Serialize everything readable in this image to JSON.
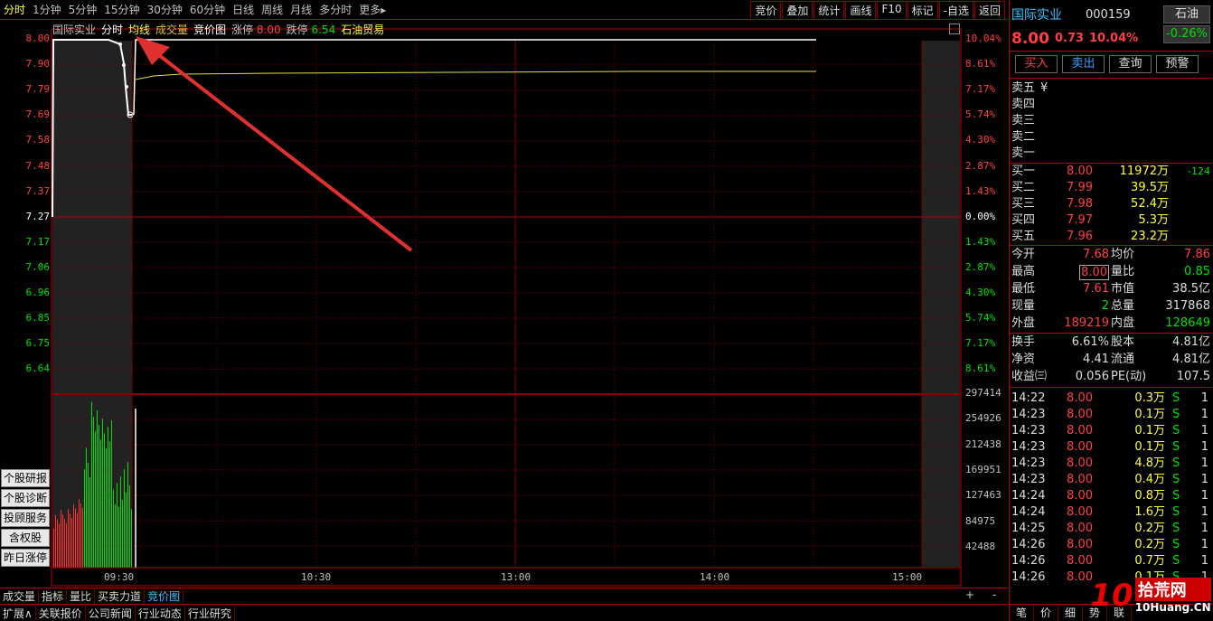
{
  "toolbar": {
    "periods": [
      "分时",
      "1分钟",
      "5分钟",
      "15分钟",
      "30分钟",
      "60分钟",
      "日线",
      "周线",
      "月线",
      "多分时",
      "更多▸"
    ],
    "buttons": [
      "竞价",
      "叠加",
      "统计",
      "画线",
      "F10",
      "标记",
      "-自选",
      "返回"
    ]
  },
  "chart_header": {
    "name": "国际实业",
    "mode": "分时",
    "avg_label": "均线",
    "vol_label": "成交量",
    "auction_label": "竞价图",
    "limit_up_label": "涨停",
    "limit_up": "8.00",
    "limit_down_label": "跌停",
    "limit_down": "6.54",
    "sector": "石油贸易"
  },
  "price_axis": {
    "labels": [
      "8.00",
      "7.90",
      "7.79",
      "7.69",
      "7.58",
      "7.48",
      "7.37",
      "7.27",
      "7.17",
      "7.06",
      "6.96",
      "6.85",
      "6.75",
      "6.64"
    ],
    "pct": [
      "10.04%",
      "8.61%",
      "7.17%",
      "5.74%",
      "4.30%",
      "2.87%",
      "1.43%",
      "0.00%",
      "1.43%",
      "2.87%",
      "4.30%",
      "5.74%",
      "7.17%",
      "8.61%"
    ]
  },
  "volume_axis": {
    "labels": [
      "297414",
      "254926",
      "212438",
      "169951",
      "127463",
      "84975",
      "42488"
    ]
  },
  "time_axis": [
    "09:30",
    "10:30",
    "13:00",
    "14:00",
    "15:00"
  ],
  "side_buttons": [
    "个股研报",
    "个股诊断",
    "投顾服务",
    "含权股",
    "昨日涨停"
  ],
  "bottom_tabs1": [
    "成交量",
    "指标",
    "量比",
    "买卖力道",
    "竞价图"
  ],
  "bottom_tabs2": [
    "扩展∧",
    "关联报价",
    "公司新闻",
    "行业动态",
    "行业研究"
  ],
  "bottom_icons": [
    "+",
    "-"
  ],
  "stock": {
    "name": "国际实业",
    "code": "000159",
    "sector": "石油",
    "sector_change": "-0.26%",
    "price": "8.00",
    "change": "0.73",
    "pct": "10.04%"
  },
  "trade_buttons": [
    "买入",
    "卖出",
    "查询",
    "预警"
  ],
  "asks": [
    {
      "label": "卖五",
      "price": "¥"
    },
    {
      "label": "卖四"
    },
    {
      "label": "卖三"
    },
    {
      "label": "卖二"
    },
    {
      "label": "卖一"
    }
  ],
  "bids": [
    {
      "label": "买一",
      "price": "8.00",
      "vol": "11972万",
      "chg": "-124"
    },
    {
      "label": "买二",
      "price": "7.99",
      "vol": "39.5万"
    },
    {
      "label": "买三",
      "price": "7.98",
      "vol": "52.4万"
    },
    {
      "label": "买四",
      "price": "7.97",
      "vol": "5.3万"
    },
    {
      "label": "买五",
      "price": "7.96",
      "vol": "23.2万"
    }
  ],
  "stats": [
    {
      "l1": "今开",
      "v1": "7.68",
      "l2": "均价",
      "v2": "7.86"
    },
    {
      "l1": "最高",
      "v1": "8.00",
      "l2": "量比",
      "v2": "0.85"
    },
    {
      "l1": "最低",
      "v1": "7.61",
      "l2": "市值",
      "v2": "38.5亿"
    },
    {
      "l1": "现量",
      "v1": "2",
      "l2": "总量",
      "v2": "317868"
    },
    {
      "l1": "外盘",
      "v1": "189219",
      "l2": "内盘",
      "v2": "128649"
    }
  ],
  "stats2": [
    {
      "l1": "换手",
      "v1": "6.61%",
      "l2": "股本",
      "v2": "4.81亿"
    },
    {
      "l1": "净资",
      "v1": "4.41",
      "l2": "流通",
      "v2": "4.81亿"
    },
    {
      "l1": "收益㈢",
      "v1": "0.056",
      "l2": "PE(动)",
      "v2": "107.5"
    }
  ],
  "ticks": [
    {
      "t": "14:22",
      "p": "8.00",
      "v": "0.3万",
      "s": "S",
      "n": "1"
    },
    {
      "t": "14:23",
      "p": "8.00",
      "v": "0.1万",
      "s": "S",
      "n": "1"
    },
    {
      "t": "14:23",
      "p": "8.00",
      "v": "0.1万",
      "s": "S",
      "n": "1"
    },
    {
      "t": "14:23",
      "p": "8.00",
      "v": "0.1万",
      "s": "S",
      "n": "1"
    },
    {
      "t": "14:23",
      "p": "8.00",
      "v": "4.8万",
      "s": "S",
      "n": "1"
    },
    {
      "t": "14:23",
      "p": "8.00",
      "v": "0.4万",
      "s": "S",
      "n": "1"
    },
    {
      "t": "14:24",
      "p": "8.00",
      "v": "0.8万",
      "s": "S",
      "n": "1"
    },
    {
      "t": "14:24",
      "p": "8.00",
      "v": "1.6万",
      "s": "S",
      "n": "1"
    },
    {
      "t": "14:25",
      "p": "8.00",
      "v": "0.2万",
      "s": "S",
      "n": "1"
    },
    {
      "t": "14:26",
      "p": "8.00",
      "v": "0.2万",
      "s": "S",
      "n": "1"
    },
    {
      "t": "14:26",
      "p": "8.00",
      "v": "0.7万",
      "s": "S",
      "n": "1"
    },
    {
      "t": "14:26",
      "p": "8.00",
      "v": "0.1万",
      "s": "S",
      "n": "1"
    }
  ],
  "rp_bottom_tabs": [
    "笔",
    "价",
    "细",
    "势",
    "联"
  ],
  "watermark": {
    "text": "拾荒网",
    "sub": "10Huang.CN"
  }
}
